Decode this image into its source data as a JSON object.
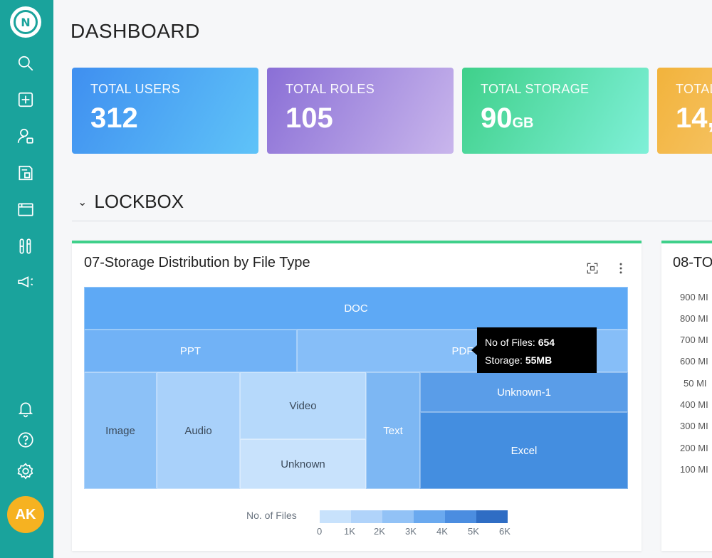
{
  "sidebar": {
    "logo_letter": "N",
    "avatar": "AK",
    "icons": [
      "search-icon",
      "add-square-icon",
      "user-settings-icon",
      "id-card-icon",
      "folder-icon",
      "tools-icon",
      "megaphone-icon",
      "bell-icon",
      "help-icon",
      "settings-icon"
    ]
  },
  "page": {
    "title": "DASHBOARD"
  },
  "stats": [
    {
      "label": "TOTAL USERS",
      "value": "312",
      "unit": ""
    },
    {
      "label": "TOTAL ROLES",
      "value": "105",
      "unit": ""
    },
    {
      "label": "TOTAL STORAGE",
      "value": "90",
      "unit": "GB"
    },
    {
      "label": "TOTAL",
      "value": "14,",
      "unit": ""
    }
  ],
  "section": {
    "chevron": "⌄",
    "title": "LOCKBOX"
  },
  "card1": {
    "title": "07-Storage Distribution by File Type",
    "treemap": [
      {
        "label": "DOC",
        "color": "#5ea9f5"
      },
      {
        "label": "PPT",
        "color": "#71b2f6"
      },
      {
        "label": "PDF",
        "color": "#86bef8"
      },
      {
        "label": "Image",
        "color": "#8cc1f7"
      },
      {
        "label": "Audio",
        "color": "#a9d1fa"
      },
      {
        "label": "Video",
        "color": "#b6d9fb"
      },
      {
        "label": "Unknown",
        "color": "#c8e2fc"
      },
      {
        "label": "Text",
        "color": "#7db7f3"
      },
      {
        "label": "Unknown-1",
        "color": "#5a9de8"
      },
      {
        "label": "Excel",
        "color": "#448ee0"
      }
    ],
    "tooltip": {
      "files_label": "No of Files:",
      "files_value": "654",
      "storage_label": "Storage:",
      "storage_value": "55MB"
    },
    "legend": {
      "title": "No. of Files",
      "colors": [
        "#c8e2fc",
        "#b0d3fa",
        "#92c2f6",
        "#6aa9ef",
        "#4b8de0",
        "#2f6dc4"
      ],
      "ticks": [
        "0",
        "1K",
        "2K",
        "3K",
        "4K",
        "5K",
        "6K"
      ]
    }
  },
  "card2": {
    "title": "08-TO",
    "yticks": [
      "900 MI",
      "800 MI",
      "700 MI",
      "600 MI",
      "50 MI",
      "400 MI",
      "300 MI",
      "200 MI",
      "100 MI"
    ]
  }
}
